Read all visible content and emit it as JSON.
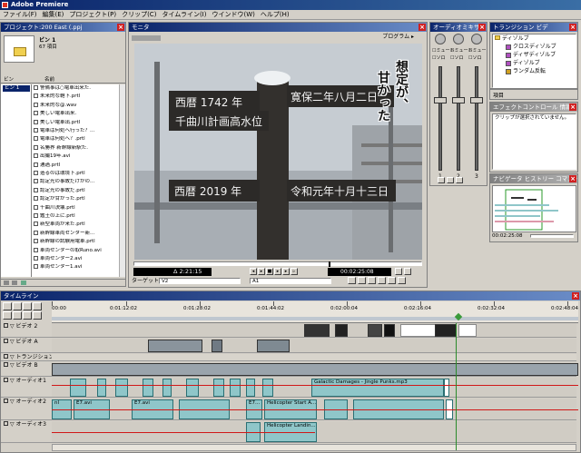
{
  "app": {
    "title": "Adobe Premiere"
  },
  "menu": [
    "ファイル(F)",
    "編集(E)",
    "プロジェクト(P)",
    "クリップ(C)",
    "タイムライン(I)",
    "ウインドウ(W)",
    "ヘルプ(H)"
  ],
  "project": {
    "title": "プロジェクト:200 East (.ppj",
    "bin_name": "ビン 1",
    "bin_count": "67 項目",
    "col_bin": "ビン",
    "col_name": "名前",
    "bin_item": "ビン 1",
    "items": [
      "警備事は○電車出来た.",
      "未来的な鞄下.prtl",
      "未来的な@.wav",
      "美しい電車出来.",
      "美しい電車出.prtl",
      "電車は何処へ行った？...",
      "電車は何処へ？.prtl",
      "名勝界 新幹線新駅た.",
      "出撮19年.avi",
      "通過.prtl",
      "造るのは環境下.prtl",
      "認定光の事故だけかの...",
      "認定光の事故だ.prtl",
      "認定が甘かった.prtl",
      "千曲川決壊.prtl",
      "鑑土の上に.prtl",
      "新型車両が来た.prtl",
      "新幹線車両センター新...",
      "新幹線の試験用電車.prtl",
      "車両センターの取Runo.avi",
      "車両センター2.avi",
      "車両センター1.avi"
    ],
    "status_mode": "List"
  },
  "monitor": {
    "title": "モニタ",
    "program_label": "プログラム ▸",
    "sign_top_left": "西暦 1742 年",
    "sign_top_right": "寛保二年八月二日",
    "sign_mid": "千曲川計画高水位",
    "sign_low_left": "西暦 2019 年",
    "sign_low_right": "令和元年十月十三日",
    "caption_col1": "想定が、",
    "caption_col2": "甘かった",
    "timecode_left": "Δ 2:21:15",
    "timecode_right": "00:02:25:08",
    "target_label": "ターゲット:",
    "target_video": "V2",
    "target_audio": "A1"
  },
  "audio_mixer": {
    "title": "オーディオミキサー",
    "ch": [
      "1",
      "2",
      "3"
    ],
    "mute": "ミュート",
    "solo": "ソロ"
  },
  "transitions": {
    "tab1": "トランジション",
    "tab2": "ビデ",
    "folder": "ディゾルブ",
    "items": [
      "クロスディゾルブ",
      "ディザディゾルブ",
      "ディゾルブ",
      "ランダム反転"
    ],
    "footer": "項目"
  },
  "effects": {
    "tab1": "エフェクトコントロール",
    "tab2": "情報",
    "message": "クリップが選択されていません。"
  },
  "navigator": {
    "tab1": "ナビゲータ",
    "tab2": "ヒストリー",
    "tab3": "コマンド",
    "timecode": "00:02:25:08"
  },
  "timeline": {
    "title": "タイムライン",
    "ruler": [
      "00:00",
      "0:01:12:02",
      "0:01:28:02",
      "0:01:44:02",
      "0:02:00:04",
      "0:02:16:04",
      "0:02:32:04",
      "0:02:48:04"
    ],
    "tracks": {
      "v2": "ビデオ 2",
      "va": "ビデオ A",
      "trans": "トランジション",
      "vb": "ビデオ B",
      "a1": "オーディオ1",
      "a2": "オーディオ2",
      "a3": "オーディオ3"
    },
    "clip_music": "Galactic Damages - Jingle Punks.mp3",
    "clip_heli1": "Helicopter Start A...",
    "clip_heli2": "Helicopter Landin...",
    "clip_e1": "E7.avi",
    "clip_e2": "E7.avi",
    "clip_e3": "E7...",
    "clip_nl": "nl"
  }
}
